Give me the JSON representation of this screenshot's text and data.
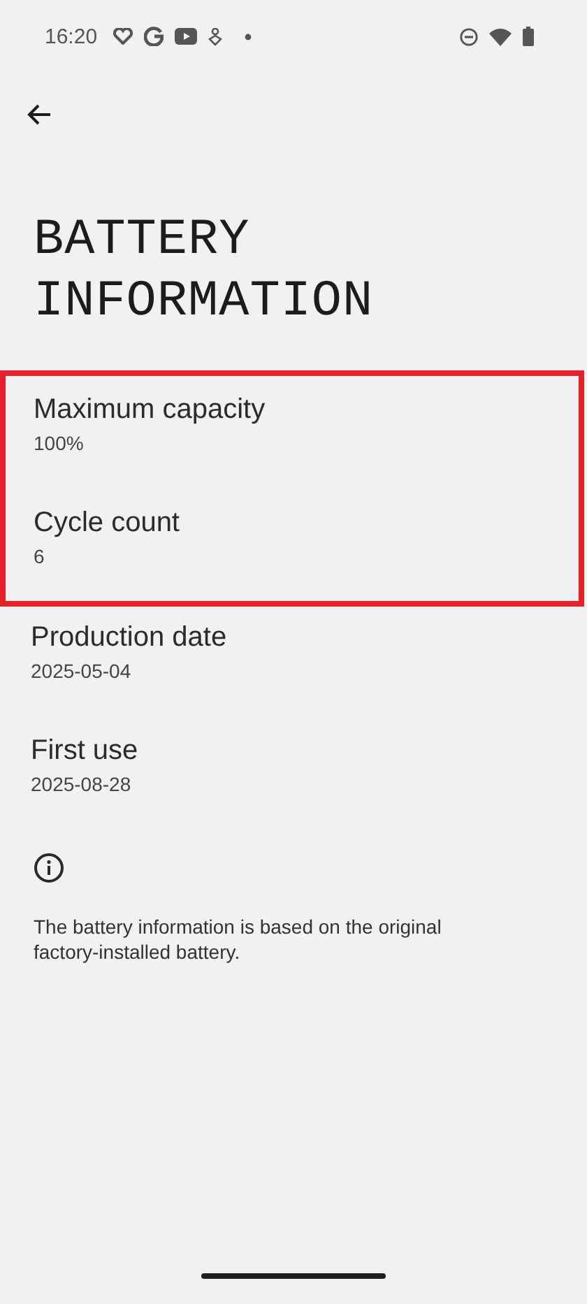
{
  "status_bar": {
    "time": "16:20"
  },
  "title": "BATTERY INFORMATION",
  "sections": [
    {
      "highlighted": true,
      "items": [
        {
          "label": "Maximum capacity",
          "value": "100%"
        },
        {
          "label": "Cycle count",
          "value": "6"
        }
      ]
    },
    {
      "highlighted": false,
      "items": [
        {
          "label": "Production date",
          "value": "2025-05-04"
        },
        {
          "label": "First use",
          "value": "2025-08-28"
        }
      ]
    }
  ],
  "note": "The battery information is based on the original factory-installed battery."
}
